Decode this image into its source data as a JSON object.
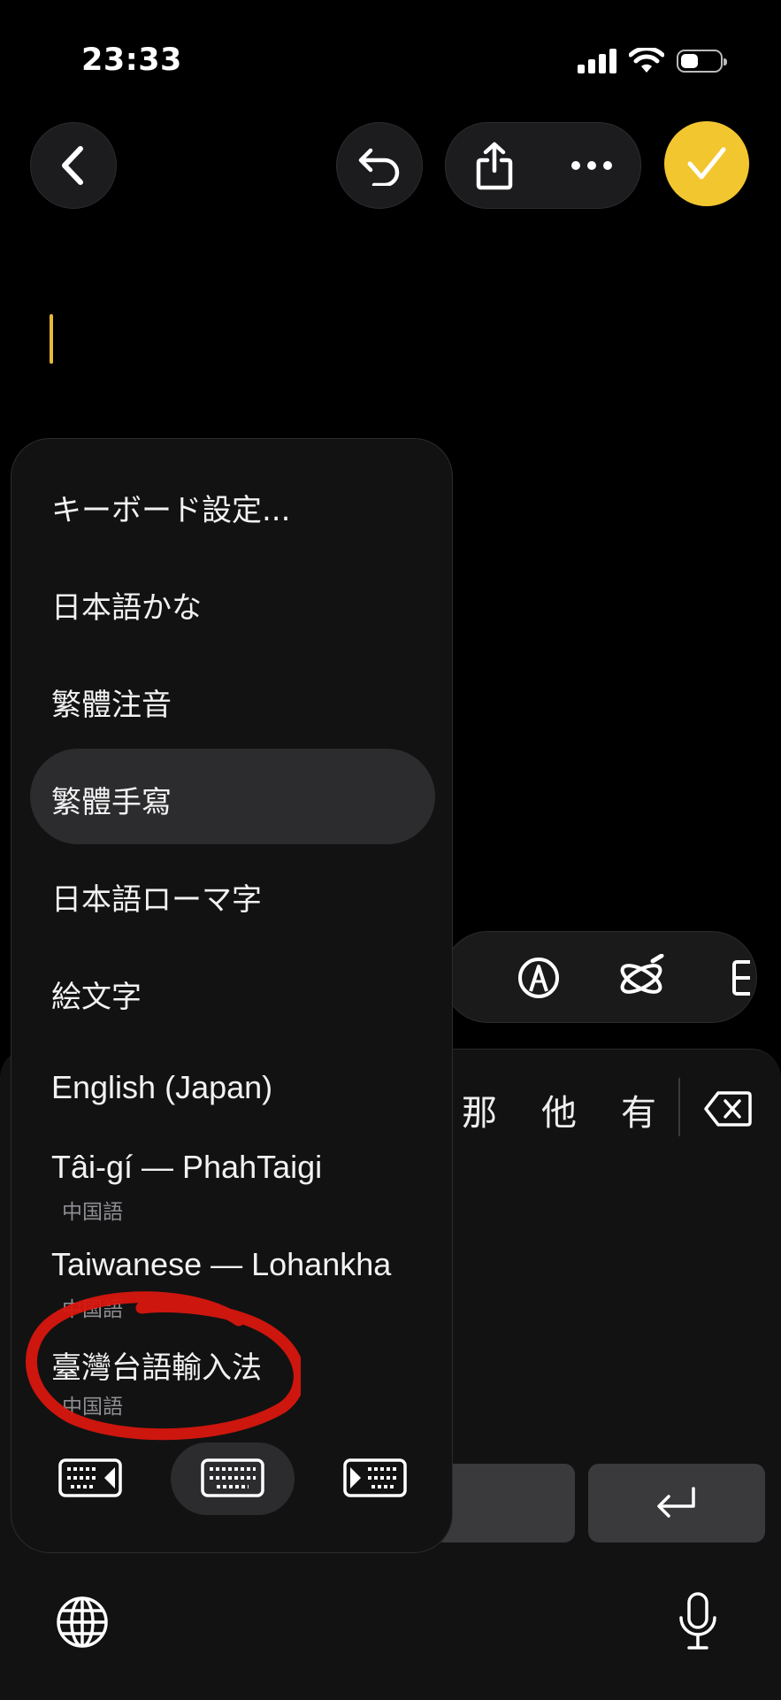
{
  "status_bar": {
    "time": "23:33",
    "battery_level": 0.45
  },
  "nav": {
    "back_icon": "chevron-left-icon",
    "undo_icon": "undo-icon",
    "share_icon": "share-icon",
    "more_icon": "ellipsis-icon",
    "done_icon": "checkmark-icon",
    "done_color": "#f2c62f"
  },
  "keyboard": {
    "candidates": [
      "那",
      "他",
      "有"
    ]
  },
  "menu": {
    "items": [
      {
        "label": "キーボード設定..."
      },
      {
        "label": "日本語かな"
      },
      {
        "label": "繁體注音"
      },
      {
        "label": "繁體手寫",
        "selected": true
      },
      {
        "label": "日本語ローマ字"
      },
      {
        "label": "絵文字"
      },
      {
        "label": "English (Japan)"
      },
      {
        "label": "Tâi-gí — PhahTaigi",
        "sublabel": "中国語"
      },
      {
        "label": "Taiwanese — Lohankha",
        "sublabel": "中国語"
      },
      {
        "label": "臺灣台語輸入法",
        "sublabel": "中国語",
        "annotated": true
      }
    ],
    "keyboard_modes": [
      "keyboard-left-icon",
      "keyboard-full-icon",
      "keyboard-right-icon"
    ],
    "selected_mode": "keyboard-full-icon"
  },
  "annotation_color": "#d8170f"
}
